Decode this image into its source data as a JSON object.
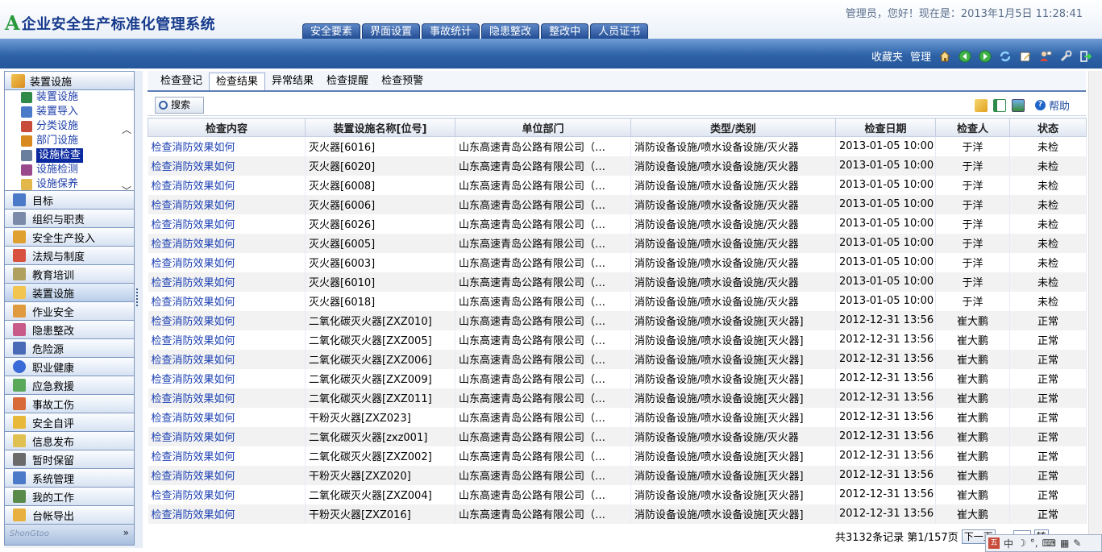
{
  "app": {
    "logo_mark": "A",
    "title": "企业安全生产标准化管理系统",
    "welcome": "管理员，您好！现在是：2013年1月5日  11:28:41"
  },
  "topnav": [
    "安全要素",
    "界面设置",
    "事故统计",
    "隐患整改",
    "整改中",
    "人员证书"
  ],
  "banner": {
    "links": [
      "收藏夹",
      "管理"
    ],
    "icons": [
      "home-icon",
      "back-icon",
      "forward-icon",
      "refresh-icon",
      "edit-icon",
      "user-icon",
      "tools-icon",
      "logout-icon"
    ]
  },
  "sidebar": {
    "header": "装置设施",
    "sub_items": [
      "装置设施",
      "装置导入",
      "分类设施",
      "部门设施",
      "设施检查",
      "设施检测",
      "设施保养"
    ],
    "active_sub": "设施检查",
    "modules": [
      "目标",
      "组织与职责",
      "安全生产投入",
      "法规与制度",
      "教育培训",
      "装置设施",
      "作业安全",
      "隐患整改",
      "危险源",
      "职业健康",
      "应急救援",
      "事故工伤",
      "安全自评",
      "信息发布",
      "暂时保留",
      "系统管理",
      "我的工作",
      "台帐导出"
    ],
    "active_module": "装置设施",
    "footer_watermark": "ShonGtoo"
  },
  "tabs": [
    "检查登记",
    "检查结果",
    "异常结果",
    "检查提醒",
    "检查预警"
  ],
  "active_tab": "检查结果",
  "toolbar": {
    "search_label": "搜索",
    "help_label": "帮助"
  },
  "table": {
    "columns": [
      "检查内容",
      "装置设施名称[位号]",
      "单位部门",
      "类型/类别",
      "检查日期",
      "检查人",
      "状态"
    ],
    "rows": [
      [
        "检查消防效果如何",
        "灭火器[6016]",
        "山东高速青岛公路有限公司（…",
        "消防设备设施/喷水设备设施/灭火器",
        "2013-01-05 10:00",
        "于洋",
        "未检"
      ],
      [
        "检查消防效果如何",
        "灭火器[6020]",
        "山东高速青岛公路有限公司（…",
        "消防设备设施/喷水设备设施/灭火器",
        "2013-01-05 10:00",
        "于洋",
        "未检"
      ],
      [
        "检查消防效果如何",
        "灭火器[6008]",
        "山东高速青岛公路有限公司（…",
        "消防设备设施/喷水设备设施/灭火器",
        "2013-01-05 10:00",
        "于洋",
        "未检"
      ],
      [
        "检查消防效果如何",
        "灭火器[6006]",
        "山东高速青岛公路有限公司（…",
        "消防设备设施/喷水设备设施/灭火器",
        "2013-01-05 10:00",
        "于洋",
        "未检"
      ],
      [
        "检查消防效果如何",
        "灭火器[6026]",
        "山东高速青岛公路有限公司（…",
        "消防设备设施/喷水设备设施/灭火器",
        "2013-01-05 10:00",
        "于洋",
        "未检"
      ],
      [
        "检查消防效果如何",
        "灭火器[6005]",
        "山东高速青岛公路有限公司（…",
        "消防设备设施/喷水设备设施/灭火器",
        "2013-01-05 10:00",
        "于洋",
        "未检"
      ],
      [
        "检查消防效果如何",
        "灭火器[6003]",
        "山东高速青岛公路有限公司（…",
        "消防设备设施/喷水设备设施/灭火器",
        "2013-01-05 10:00",
        "于洋",
        "未检"
      ],
      [
        "检查消防效果如何",
        "灭火器[6010]",
        "山东高速青岛公路有限公司（…",
        "消防设备设施/喷水设备设施/灭火器",
        "2013-01-05 10:00",
        "于洋",
        "未检"
      ],
      [
        "检查消防效果如何",
        "灭火器[6018]",
        "山东高速青岛公路有限公司（…",
        "消防设备设施/喷水设备设施/灭火器",
        "2013-01-05 10:00",
        "于洋",
        "未检"
      ],
      [
        "检查消防效果如何",
        "二氧化碳灭火器[ZXZ010]",
        "山东高速青岛公路有限公司（…",
        "消防设备设施/喷水设备设施[灭火器]",
        "2012-12-31 13:56",
        "崔大鹏",
        "正常"
      ],
      [
        "检查消防效果如何",
        "二氧化碳灭火器[ZXZ005]",
        "山东高速青岛公路有限公司（…",
        "消防设备设施/喷水设备设施[灭火器]",
        "2012-12-31 13:56",
        "崔大鹏",
        "正常"
      ],
      [
        "检查消防效果如何",
        "二氧化碳灭火器[ZXZ006]",
        "山东高速青岛公路有限公司（…",
        "消防设备设施/喷水设备设施[灭火器]",
        "2012-12-31 13:56",
        "崔大鹏",
        "正常"
      ],
      [
        "检查消防效果如何",
        "二氧化碳灭火器[ZXZ009]",
        "山东高速青岛公路有限公司（…",
        "消防设备设施/喷水设备设施[灭火器]",
        "2012-12-31 13:56",
        "崔大鹏",
        "正常"
      ],
      [
        "检查消防效果如何",
        "二氧化碳灭火器[ZXZ011]",
        "山东高速青岛公路有限公司（…",
        "消防设备设施/喷水设备设施[灭火器]",
        "2012-12-31 13:56",
        "崔大鹏",
        "正常"
      ],
      [
        "检查消防效果如何",
        "干粉灭火器[ZXZ023]",
        "山东高速青岛公路有限公司（…",
        "消防设备设施/喷水设备设施[灭火器]",
        "2012-12-31 13:56",
        "崔大鹏",
        "正常"
      ],
      [
        "检查消防效果如何",
        "二氧化碳灭火器[zxz001]",
        "山东高速青岛公路有限公司（…",
        "消防设备设施/喷水设备设施/灭火器",
        "2012-12-31 13:56",
        "崔大鹏",
        "正常"
      ],
      [
        "检查消防效果如何",
        "二氧化碳灭火器[ZXZ002]",
        "山东高速青岛公路有限公司（…",
        "消防设备设施/喷水设备设施[灭火器]",
        "2012-12-31 13:56",
        "崔大鹏",
        "正常"
      ],
      [
        "检查消防效果如何",
        "干粉灭火器[ZXZ020]",
        "山东高速青岛公路有限公司（…",
        "消防设备设施/喷水设备设施[灭火器]",
        "2012-12-31 13:56",
        "崔大鹏",
        "正常"
      ],
      [
        "检查消防效果如何",
        "二氧化碳灭火器[ZXZ004]",
        "山东高速青岛公路有限公司（…",
        "消防设备设施/喷水设备设施[灭火器]",
        "2012-12-31 13:56",
        "崔大鹏",
        "正常"
      ],
      [
        "检查消防效果如何",
        "干粉灭火器[ZXZ016]",
        "山东高速青岛公路有限公司（…",
        "消防设备设施/喷水设备设施[灭火器]",
        "2012-12-31 13:56",
        "崔大鹏",
        "正常"
      ]
    ]
  },
  "pager": {
    "summary": "共3132条记录 第1/157页",
    "next_label": "下一页",
    "go_label": "转"
  },
  "ime": {
    "mode": "中"
  },
  "colors": {
    "banner": "#2e63a8",
    "topnav_tab": "#234d93",
    "link_blue": "#1a3fb2",
    "logo_green": "#2a9a3a",
    "logo_navy": "#163a8c"
  }
}
